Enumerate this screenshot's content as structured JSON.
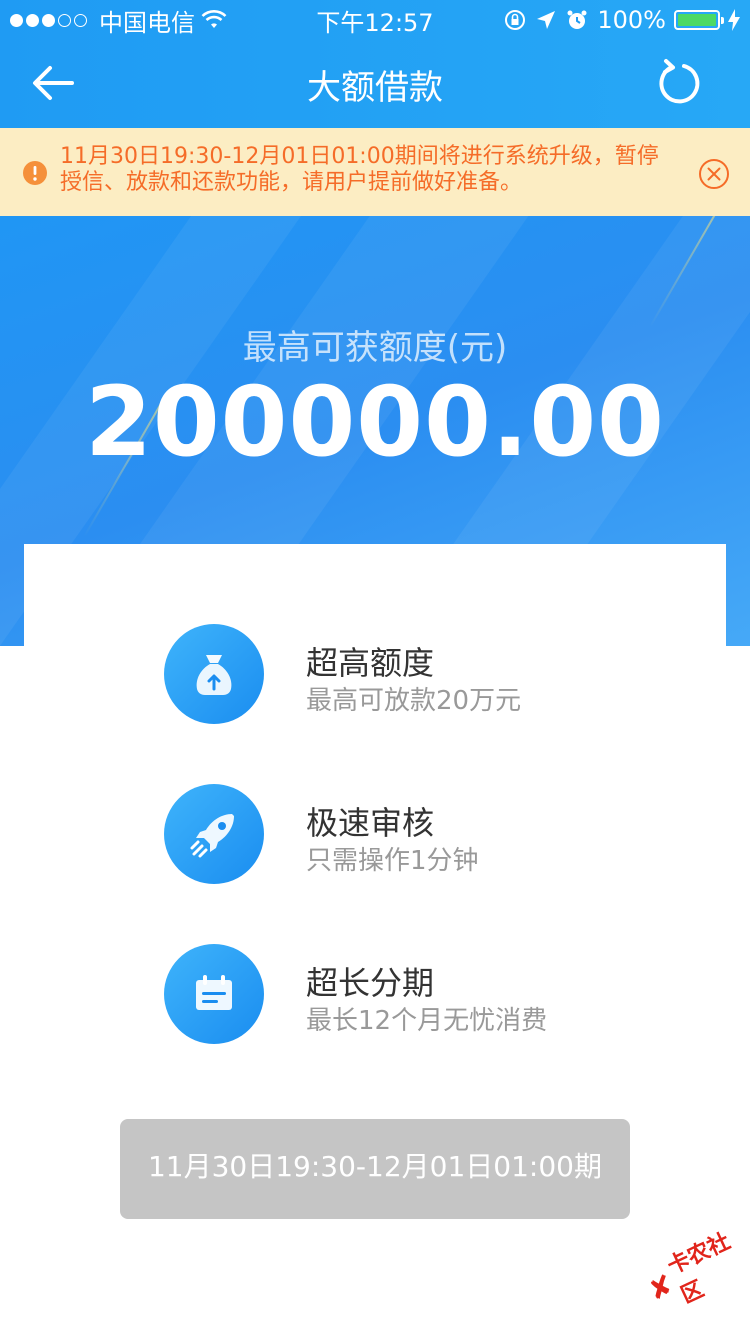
{
  "status_bar": {
    "carrier": "中国电信",
    "time": "下午12:57",
    "battery": "100%"
  },
  "nav": {
    "title": "大额借款"
  },
  "notice": {
    "text": "11月30日19:30-12月01日01:00期间将进行系统升级，暂停授信、放款和还款功能，请用户提前做好准备。"
  },
  "hero": {
    "label": "最高可获额度(元)",
    "amount": "200000.00"
  },
  "features": [
    {
      "title": "超高额度",
      "subtitle": "最高可放款20万元",
      "icon": "money-bag-icon"
    },
    {
      "title": "极速审核",
      "subtitle": "只需操作1分钟",
      "icon": "rocket-icon"
    },
    {
      "title": "超长分期",
      "subtitle": "最长12个月无忧消费",
      "icon": "calendar-icon"
    }
  ],
  "button": {
    "label": "11月30日19:30-12月01日01:00期"
  },
  "watermark": {
    "text": "卡农社区"
  },
  "colors": {
    "primary_blue": "#1f9bf3",
    "notice_bg": "#fcedc3",
    "notice_text": "#f56c28",
    "disabled_button": "#c5c5c5"
  }
}
